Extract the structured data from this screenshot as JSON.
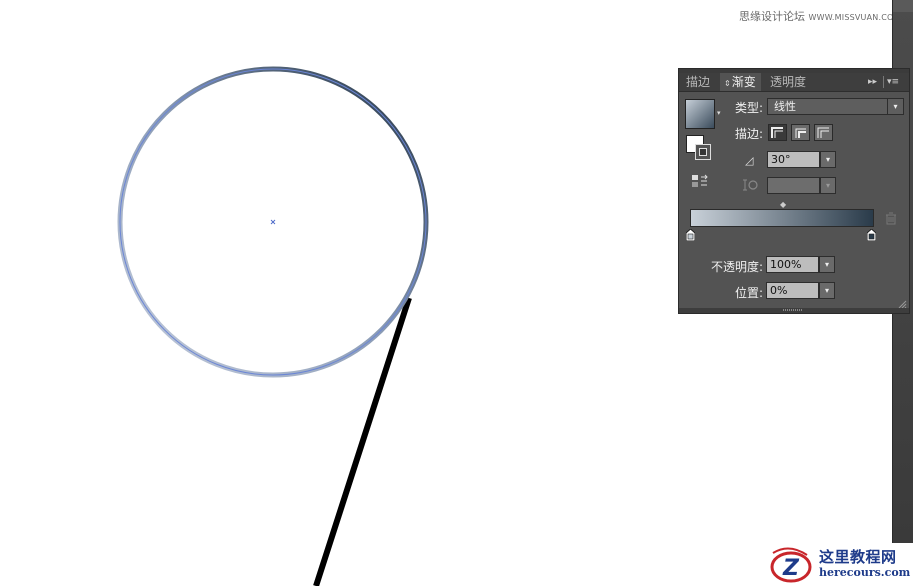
{
  "watermark": {
    "cn": "思缘设计论坛",
    "site": "WWW.MISSVUAN.COM"
  },
  "panel": {
    "tabs": [
      {
        "label": "描边",
        "active": false
      },
      {
        "label": "渐变",
        "active": true
      },
      {
        "label": "透明度",
        "active": false
      }
    ],
    "type_label": "类型:",
    "type_value": "线性",
    "stroke_label": "描边:",
    "angle_value": "30°",
    "aspect_value": "",
    "opacity_label": "不透明度:",
    "opacity_value": "100%",
    "location_label": "位置:",
    "location_value": "0%",
    "gradient": {
      "start_color": "#c8d0d8",
      "end_color": "#2a3b4a"
    }
  },
  "logo": {
    "cn": "这里教程网",
    "url": "herecours.com",
    "mark_letter": "Z"
  },
  "icons": {
    "swatch_arrow": "▾",
    "caret": "▾",
    "angle": "◿",
    "midpoint": "◆",
    "collapse": "▸▸",
    "menu": "▾≡",
    "updown": "⇕"
  }
}
